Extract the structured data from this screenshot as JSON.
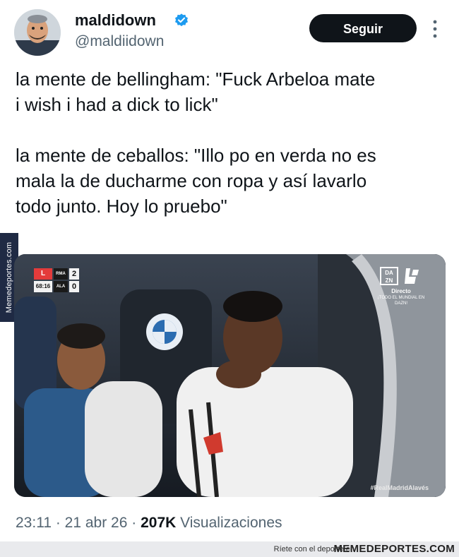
{
  "author": {
    "display_name": "maldidown",
    "handle": "@maldiidown",
    "verified": true
  },
  "follow_button": {
    "label": "Seguir"
  },
  "tweet": {
    "text": "la mente de bellingham: \"Fuck Arbeloa mate\ni wish i had a dick to lick\"\n\nla mente de ceballos: \"Illo po en verda no es\nmala la de ducharme con ropa y así lavarlo\ntodo junto. Hoy lo pruebo\""
  },
  "media": {
    "scorebug": {
      "clock": "68:16",
      "team_home": "RMA",
      "team_away": "ALA",
      "score_home": "2",
      "score_away": "0"
    },
    "broadcaster": {
      "logo_text": "DA ZN",
      "live_label": "Directo",
      "promo": "¡TODO EL MUNDIAL EN DAZN!"
    },
    "hashtag": "#RealMadridAlavés",
    "sponsor_text": "BMW"
  },
  "meta": {
    "time": "23:11",
    "date": "21 abr 26",
    "views_count": "207K",
    "views_label": "Visualizaciones"
  },
  "watermark": {
    "side": "Memedeportes.com",
    "footer_tagline": "Ríete con el deporte en",
    "footer_brand": "MEMEDEPORTES.COM"
  },
  "colors": {
    "follow_bg": "#0f1419",
    "verified": "#1d9bf0",
    "secondary_text": "#536471"
  },
  "icons": {
    "verified": "verified-badge-icon",
    "more": "more-vertical-icon"
  }
}
